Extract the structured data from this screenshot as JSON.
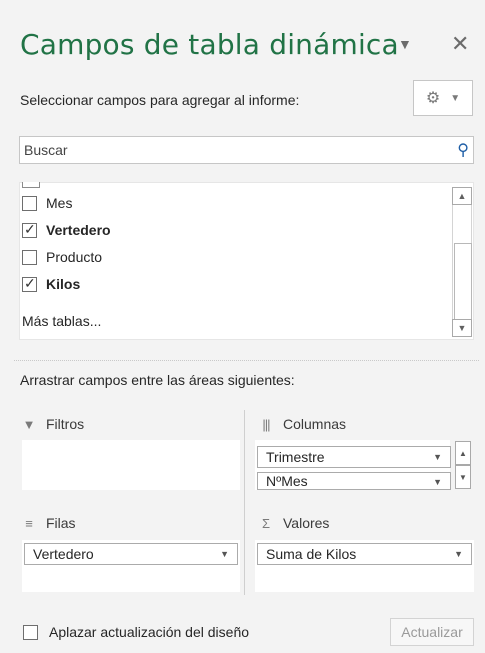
{
  "header": {
    "title": "Campos de tabla dinámica",
    "menu_icon": "chevron-down-icon",
    "close_icon": "close-icon"
  },
  "subtitle": "Seleccionar campos para agregar al informe:",
  "tools_button": {
    "icon": "gear-icon",
    "dropdown_icon": "chevron-down-icon"
  },
  "search": {
    "placeholder": "Buscar",
    "value": "",
    "icon": "search-icon"
  },
  "fields": [
    {
      "label": "Mes",
      "checked": false
    },
    {
      "label": "Vertedero",
      "checked": true
    },
    {
      "label": "Producto",
      "checked": false
    },
    {
      "label": "Kilos",
      "checked": true
    }
  ],
  "more_tables": "Más tablas...",
  "drag_label": "Arrastrar campos entre las áreas siguientes:",
  "areas": {
    "filters": {
      "label": "Filtros",
      "icon": "filter-icon",
      "items": []
    },
    "columns": {
      "label": "Columnas",
      "icon": "columns-icon",
      "items": [
        "Trimestre",
        "NºMes"
      ]
    },
    "rows": {
      "label": "Filas",
      "icon": "rows-icon",
      "items": [
        "Vertedero"
      ]
    },
    "values": {
      "label": "Valores",
      "icon": "sigma-icon",
      "items": [
        "Suma de Kilos"
      ]
    }
  },
  "footer": {
    "defer_label": "Aplazar actualización del diseño",
    "defer_checked": false,
    "update_label": "Actualizar"
  },
  "colors": {
    "title": "#217346",
    "panel_bg": "#f3f3f3",
    "search_icon": "#1e5ea6"
  }
}
